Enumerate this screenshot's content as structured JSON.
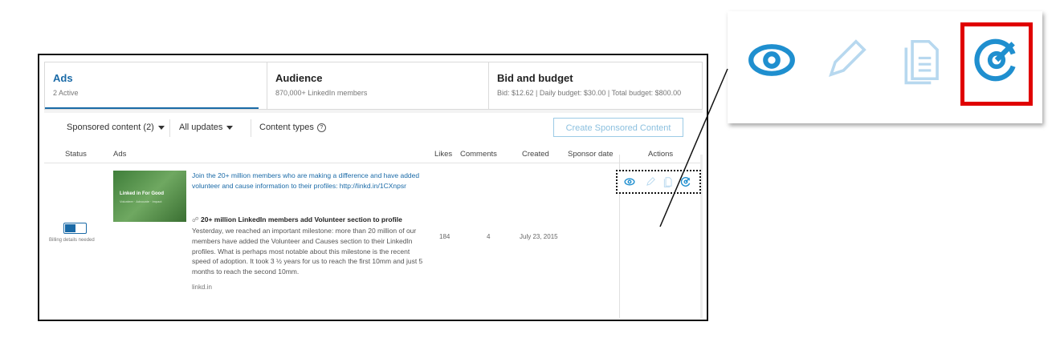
{
  "tabs": [
    {
      "title": "Ads",
      "sub": "2 Active"
    },
    {
      "title": "Audience",
      "sub": "870,000+ LinkedIn members"
    },
    {
      "title": "Bid and budget",
      "sub": "Bid: $12.62 | Daily budget: $30.00 | Total budget: $800.00"
    }
  ],
  "filters": {
    "sponsored": "Sponsored content (2)",
    "updates": "All updates",
    "content_types": "Content types",
    "help_glyph": "?"
  },
  "create_button": "Create Sponsored Content",
  "columns": {
    "status": "Status",
    "ads": "Ads",
    "likes": "Likes",
    "comments": "Comments",
    "created": "Created",
    "sponsor_date": "Sponsor date",
    "actions": "Actions"
  },
  "row": {
    "billing": "Billing details needed",
    "thumb_brand": "Linked in For Good",
    "thumb_sub": "Volunteer · Advocate · Impact",
    "title": "Join the 20+ million members who are making a difference and have added volunteer and cause information to their profiles: http://linkd.in/1CXnpsr",
    "subtitle": "20+ million LinkedIn members add Volunteer section to profile",
    "body": "Yesterday, we reached an important milestone: more than 20 million of our members have added the Volunteer and Causes section to their LinkedIn profiles. What is perhaps most notable about this milestone is the recent speed of adoption. It took 3 ½ years for us to reach the first 10mm and just 5 months to reach the second 10mm.",
    "link": "linkd.in",
    "likes": "184",
    "comments": "4",
    "created": "July 23, 2015",
    "toggle_on": true
  },
  "icons": [
    "eye-icon",
    "pencil-icon",
    "copy-document-icon",
    "target-gauge-icon"
  ],
  "colors": {
    "accent": "#1a6aa7",
    "icon_blue": "#1f8fcf",
    "highlight": "#e00000"
  }
}
